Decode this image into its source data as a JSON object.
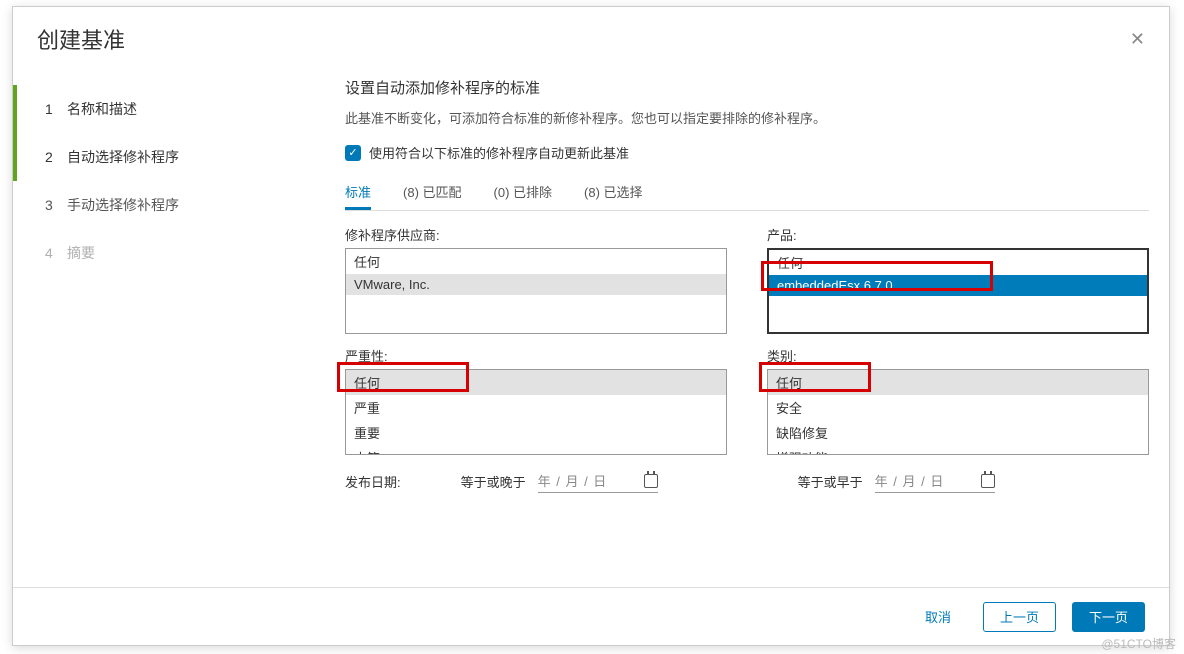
{
  "dialog": {
    "title": "创建基准"
  },
  "steps": {
    "s1": {
      "num": "1",
      "label": "名称和描述"
    },
    "s2": {
      "num": "2",
      "label": "自动选择修补程序"
    },
    "s3": {
      "num": "3",
      "label": "手动选择修补程序"
    },
    "s4": {
      "num": "4",
      "label": "摘要"
    }
  },
  "main": {
    "heading": "设置自动添加修补程序的标准",
    "desc": "此基准不断变化，可添加符合标准的新修补程序。您也可以指定要排除的修补程序。",
    "checkbox_label": "使用符合以下标准的修补程序自动更新此基准"
  },
  "tabs": {
    "criteria": "标准",
    "matched": "(8) 已匹配",
    "excluded": "(0) 已排除",
    "selected": "(8) 已选择"
  },
  "filters": {
    "vendor_label": "修补程序供应商:",
    "vendor_any": "任何",
    "vendor_vmware": "VMware, Inc.",
    "product_label": "产品:",
    "product_any": "任何",
    "product_esx": "embeddedEsx 6.7.0",
    "severity_label": "严重性:",
    "sev_any": "任何",
    "sev_critical": "严重",
    "sev_important": "重要",
    "sev_moderate": "中等",
    "category_label": "类别:",
    "cat_any": "任何",
    "cat_security": "安全",
    "cat_bugfix": "缺陷修复",
    "cat_enhancement": "增强功能",
    "release_label": "发布日期:",
    "after_label": "等于或晚于",
    "before_label": "等于或早于",
    "date_placeholder": "年 / 月 / 日"
  },
  "footer": {
    "cancel": "取消",
    "back": "上一页",
    "next": "下一页"
  },
  "watermark": "@51CTO博客"
}
